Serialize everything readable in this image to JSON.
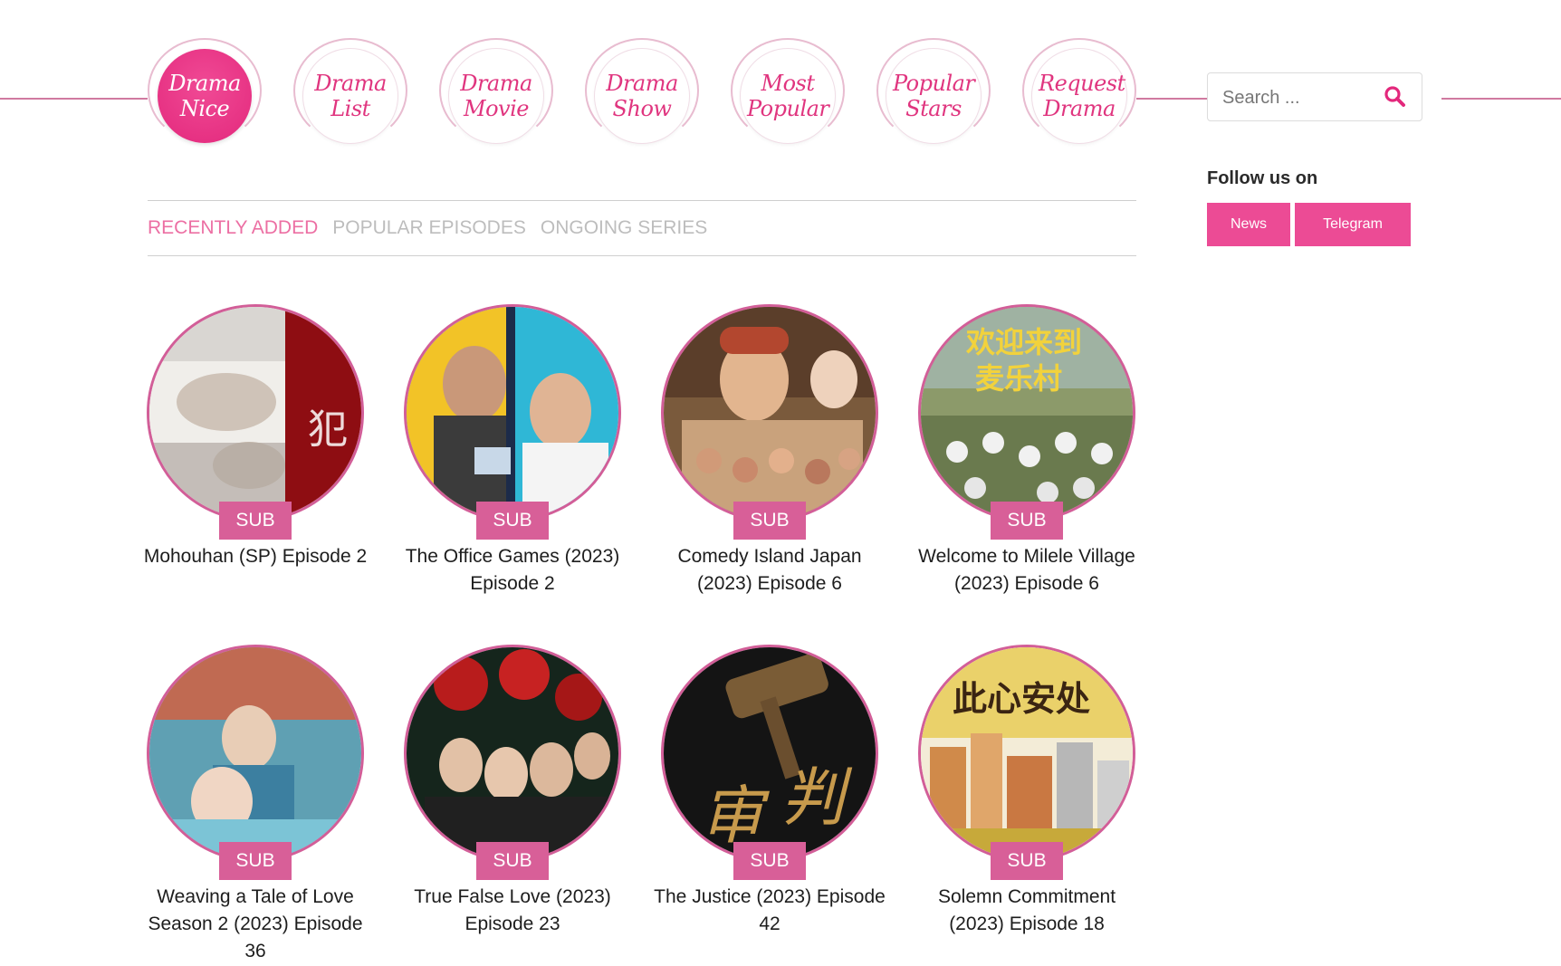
{
  "nav": {
    "items": [
      {
        "label_line1": "Drama",
        "label_line2": "Nice",
        "active": true
      },
      {
        "label_line1": "Drama",
        "label_line2": "List",
        "active": false
      },
      {
        "label_line1": "Drama",
        "label_line2": "Movie",
        "active": false
      },
      {
        "label_line1": "Drama",
        "label_line2": "Show",
        "active": false
      },
      {
        "label_line1": "Most",
        "label_line2": "Popular",
        "active": false
      },
      {
        "label_line1": "Popular",
        "label_line2": "Stars",
        "active": false
      },
      {
        "label_line1": "Request",
        "label_line2": "Drama",
        "active": false
      }
    ]
  },
  "search": {
    "placeholder": "Search ...",
    "icon": "search-icon"
  },
  "follow": {
    "title": "Follow us on",
    "news_label": "News",
    "telegram_label": "Telegram"
  },
  "tabs": [
    {
      "label": "RECENTLY ADDED",
      "active": true
    },
    {
      "label": "POPULAR EPISODES",
      "active": false
    },
    {
      "label": "ONGOING SERIES",
      "active": false
    }
  ],
  "badge_label": "SUB",
  "colors": {
    "accent": "#ec4b95",
    "badge": "#d85f98",
    "ring": "#d25e98",
    "tab_active": "#ec6fa3",
    "tab_inactive": "#bdbdbd"
  },
  "episodes": [
    {
      "title": "Mohouhan (SP) Episode 2"
    },
    {
      "title": "The Office Games (2023) Episode 2"
    },
    {
      "title": "Comedy Island Japan (2023) Episode 6"
    },
    {
      "title": "Welcome to Milele Village (2023) Episode 6"
    },
    {
      "title": "Weaving a Tale of Love Season 2 (2023) Episode 36"
    },
    {
      "title": "True False Love (2023) Episode 23"
    },
    {
      "title": "The Justice (2023) Episode 42"
    },
    {
      "title": "Solemn Commitment (2023) Episode 18"
    }
  ]
}
